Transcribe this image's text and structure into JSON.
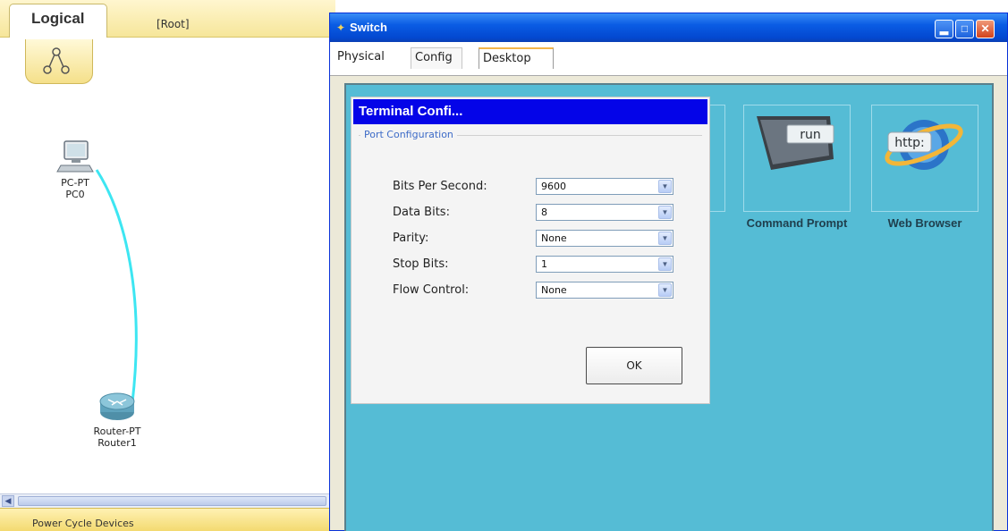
{
  "workspace": {
    "tab_label": "Logical",
    "root_label": "[Root]",
    "status_text": "Power Cycle Devices",
    "devices": [
      {
        "type": "PC-PT",
        "name": "PC0"
      },
      {
        "type": "Router-PT",
        "name": "Router1"
      }
    ]
  },
  "window": {
    "title": "Switch",
    "tabs": [
      "Physical",
      "Config",
      "Desktop"
    ],
    "active_tab": "Desktop",
    "desktop_apps": [
      {
        "label": "Command Prompt",
        "icon": "command-prompt-icon",
        "icon_text": "run"
      },
      {
        "label": "Web Browser",
        "icon": "web-browser-icon",
        "icon_text": "http:"
      }
    ]
  },
  "dialog": {
    "title": "Terminal Confi...",
    "group_title": "Port Configuration",
    "fields": [
      {
        "label": "Bits Per Second:",
        "value": "9600"
      },
      {
        "label": "Data Bits:",
        "value": "8"
      },
      {
        "label": "Parity:",
        "value": "None"
      },
      {
        "label": "Stop Bits:",
        "value": "1"
      },
      {
        "label": "Flow Control:",
        "value": "None"
      }
    ],
    "ok_label": "OK"
  },
  "colors": {
    "desktop_bg": "#55bcd5",
    "dialog_title_bg": "#0404e8",
    "cable": "#3de6f2",
    "workspace_bar": "#f6e69a"
  }
}
